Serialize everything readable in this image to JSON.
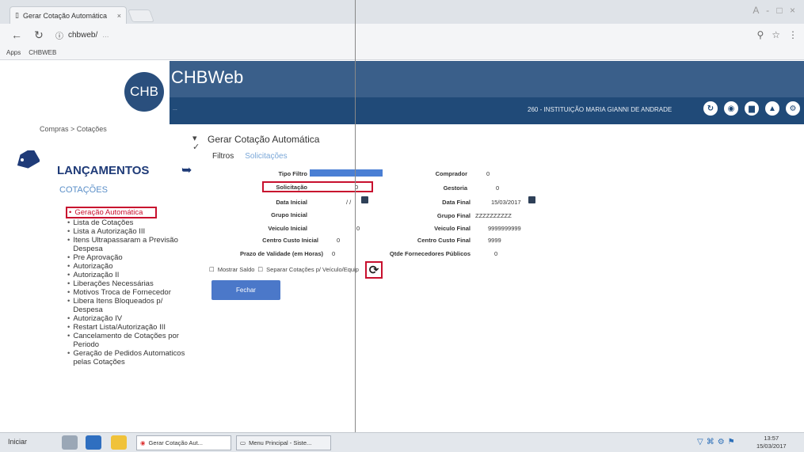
{
  "browser": {
    "tab_title": "Gerar Cotação Automática",
    "tab_close": "×",
    "url_visible": "chbweb/",
    "url_blurred": "...",
    "bookmarks": [
      "Apps",
      "CHBWEB"
    ],
    "window_controls": "A - □ ×"
  },
  "app": {
    "logo_text": "CHB",
    "title": "CHBWeb",
    "header_info": "...",
    "institution": "260 - INSTITUIÇÃO MARIA GIANNI DE ANDRADE",
    "header_icons": [
      "refresh-icon",
      "user-icon",
      "truck-icon",
      "factory-icon",
      "settings-icon"
    ]
  },
  "breadcrumb": "Compras > Cotações",
  "sidebar": {
    "title": "LANÇAMENTOS",
    "subtitle": "COTAÇÕES",
    "items": [
      {
        "label": "Geração Automática",
        "active": true
      },
      {
        "label": "Lista de Cotações"
      },
      {
        "label": "Lista a Autorização III"
      },
      {
        "label": "Itens Ultrapassaram a Previsão Despesa"
      },
      {
        "label": "Pre Aprovação"
      },
      {
        "label": "Autorização"
      },
      {
        "label": "Autorização II"
      },
      {
        "label": "Liberações Necessárias"
      },
      {
        "label": "Motivos Troca de Fornecedor"
      },
      {
        "label": "Libera Itens Bloqueados p/ Despesa"
      },
      {
        "label": "Autorização IV"
      },
      {
        "label": "Restart Lista/Autorização III"
      },
      {
        "label": "Cancelamento de Cotações por Periodo"
      },
      {
        "label": "Geração de Pedidos Automaticos pelas Cotações"
      }
    ]
  },
  "main": {
    "title": "Gerar Cotação Automática",
    "tabs": [
      "Filtros",
      "Solicitações"
    ],
    "fields": {
      "tipo_filtro_label": "Tipo Filtro",
      "tipo_filtro_value": "",
      "solicitacao_label": "Solicitação",
      "solicitacao_value": "0",
      "data_inicial_label": "Data Inicial",
      "data_inicial_value": "/ /",
      "grupo_inicial_label": "Grupo Inicial",
      "veiculo_inicial_label": "Veiculo Inicial",
      "veiculo_inicial_value": "0",
      "centro_custo_inicial_label": "Centro Custo Inicial",
      "centro_custo_inicial_value": "0",
      "prazo_validade_label": "Prazo de Validade (em Horas)",
      "prazo_validade_value": "0",
      "comprador_label": "Comprador",
      "comprador_value": "0",
      "gestoria_label": "Gestoria",
      "gestoria_value": "0",
      "data_final_label": "Data Final",
      "data_final_value": "15/03/2017",
      "grupo_final_label": "Grupo Final",
      "grupo_final_value": "ZZZZZZZZZZ",
      "veiculo_final_label": "Veiculo Final",
      "veiculo_final_value": "9999999999",
      "centro_custo_final_label": "Centro Custo Final",
      "centro_custo_final_value": "9999",
      "qtde_fornecedores_label": "Qtde Fornecedores Públicos",
      "qtde_fornecedores_value": "0"
    },
    "checkbox_mostrar_saldo": "Mostrar Saldo",
    "checkbox_separar": "Separar Cotações p/ Veículo/Equip",
    "button_fechar": "Fechar"
  },
  "taskbar": {
    "start": "Iniciar",
    "btn1": "Gerar Cotação Aut...",
    "btn2": "Menu Principal - Siste...",
    "time": "13:57",
    "date": "15/03/2017"
  },
  "colors": {
    "header_band": "#3a5f8a",
    "header_dark": "#204a78",
    "highlight_red": "#c8102e",
    "sidebar_title": "#1f3b78",
    "button_blue": "#4b78c9"
  }
}
